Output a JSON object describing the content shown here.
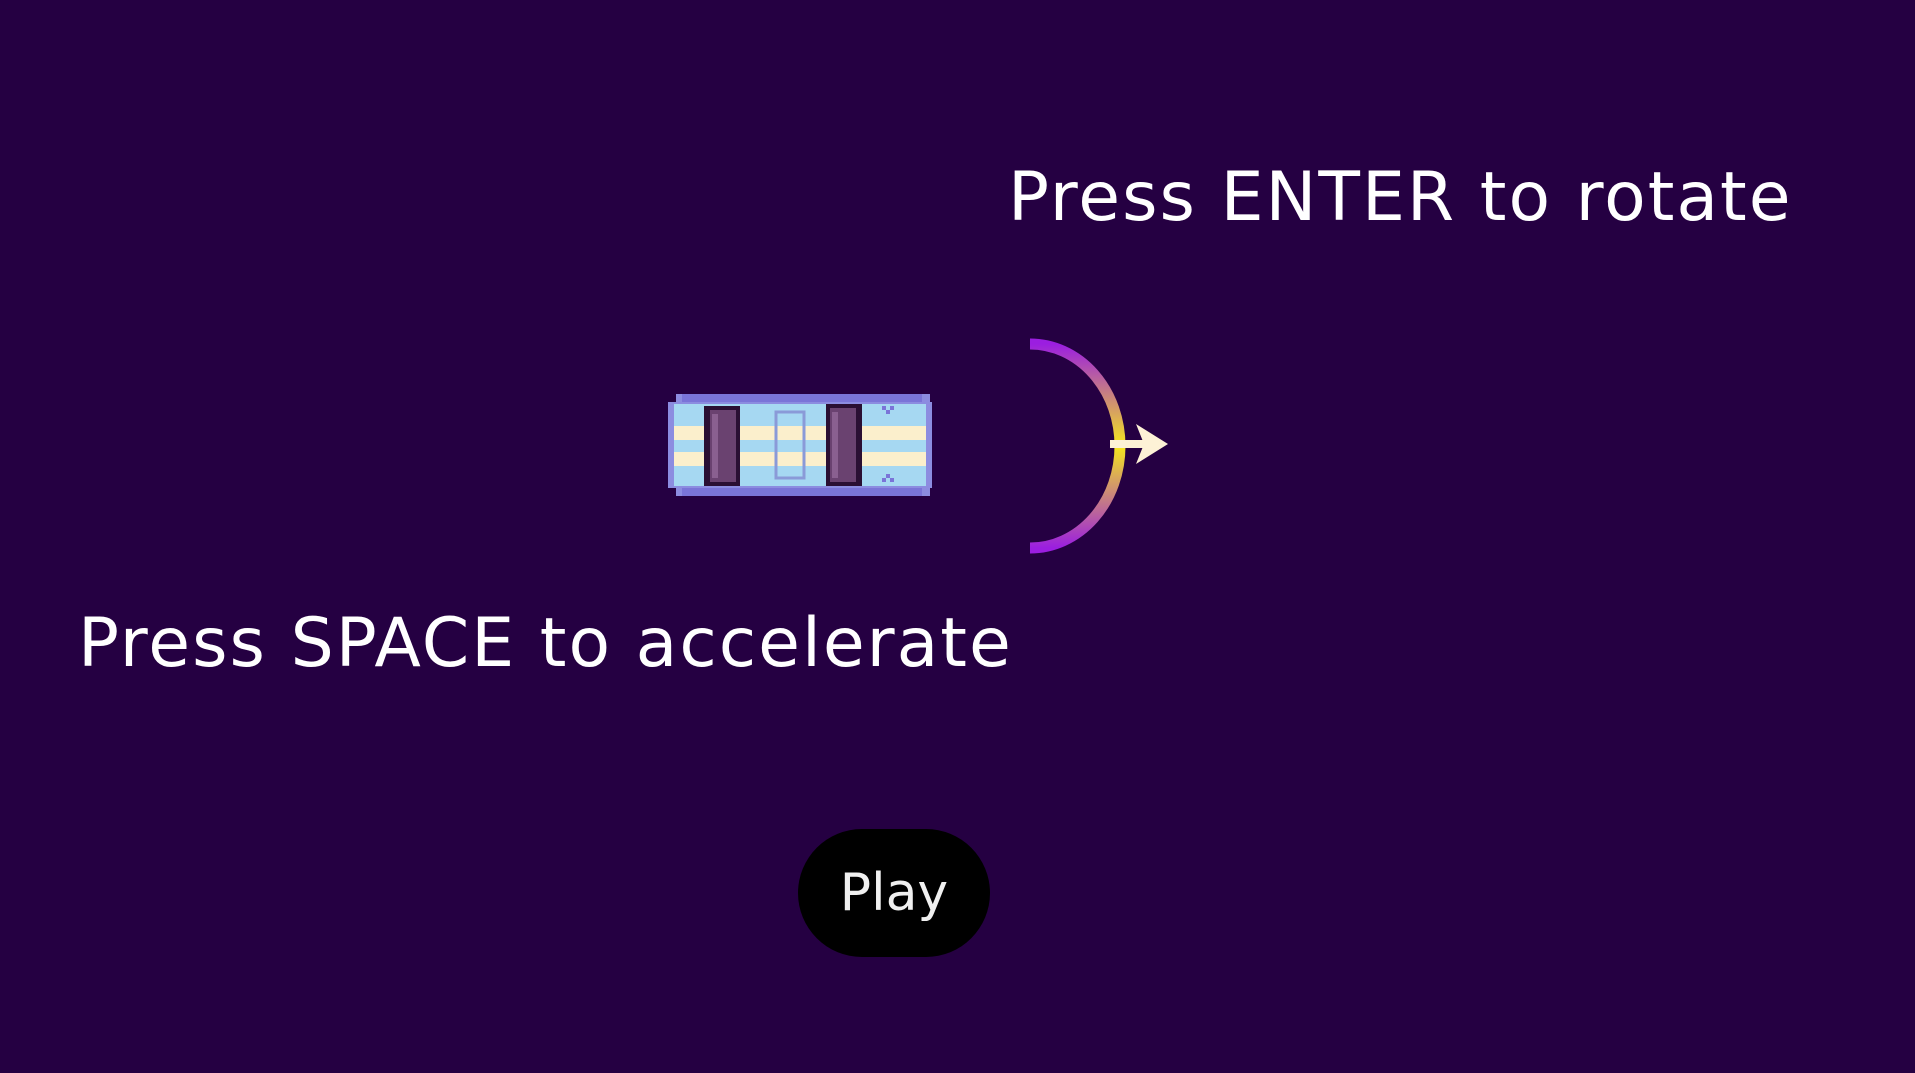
{
  "instructions": {
    "rotate": "Press ENTER to rotate",
    "accelerate": "Press SPACE to accelerate"
  },
  "play_button": {
    "label": "Play"
  },
  "sprites": {
    "car": "car-sprite",
    "rotate_indicator": "rotation-arc-arrow-icon"
  },
  "colors": {
    "background": "#250042",
    "text": "#ffffff",
    "play_button_bg": "#000000",
    "play_button_text": "#f0f0f0",
    "arc_start": "#9b1ee0",
    "arc_end": "#f5e61e",
    "arrow": "#fdf2d6"
  }
}
